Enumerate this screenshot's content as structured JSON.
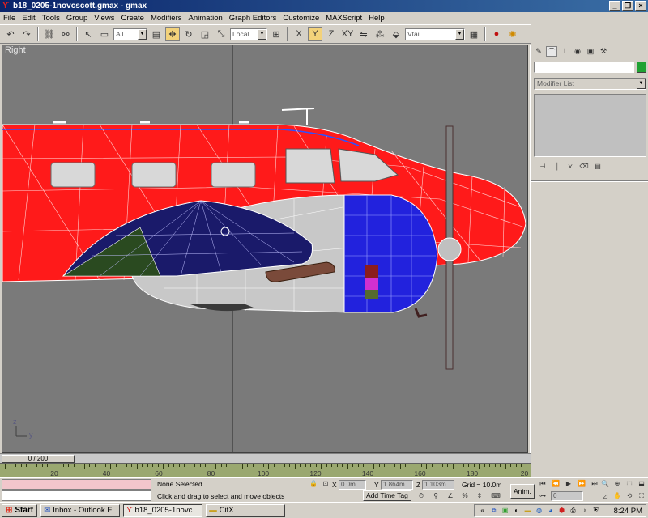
{
  "window": {
    "title": "b18_0205-1novcscott.gmax - gmax",
    "minimize_glyph": "_",
    "restore_glyph": "❐",
    "close_glyph": "×"
  },
  "menu": [
    "File",
    "Edit",
    "Tools",
    "Group",
    "Views",
    "Create",
    "Modifiers",
    "Animation",
    "Graph Editors",
    "Customize",
    "MAXScript",
    "Help"
  ],
  "toolbar": {
    "selection_filter": "All",
    "reference_coord": "Local",
    "named_selection": "Vtail"
  },
  "viewport": {
    "label": "Right",
    "axis_z": "z",
    "axis_y": "y",
    "background_color": "#7a7a7a",
    "fuselage_color": "#ff2020",
    "cowling_color": "#2020e0"
  },
  "command_panel": {
    "name_value": "",
    "swatch_color": "#1fa233",
    "modifier_list": "Modifier List"
  },
  "timeline": {
    "slider_text": "0 / 200",
    "ticks": [
      "20",
      "40",
      "60",
      "80",
      "100",
      "120",
      "140",
      "160",
      "180",
      "20"
    ]
  },
  "status": {
    "selection_text": "None Selected",
    "prompt_text": "Click and drag to select and move objects",
    "x_label": "X",
    "x_value": "0.0m",
    "y_label": "Y",
    "y_value": "1.864m",
    "z_label": "Z",
    "z_value": "1.103m",
    "grid_text": "Grid = 10.0m",
    "add_time_tag": "Add Time Tag",
    "anim_label": "Anim.",
    "frame_value": "0"
  },
  "taskbar": {
    "start_label": "Start",
    "tasks": [
      "Inbox - Outlook E...",
      "b18_0205-1novc...",
      "CitX"
    ],
    "clock": "8:24 PM"
  }
}
